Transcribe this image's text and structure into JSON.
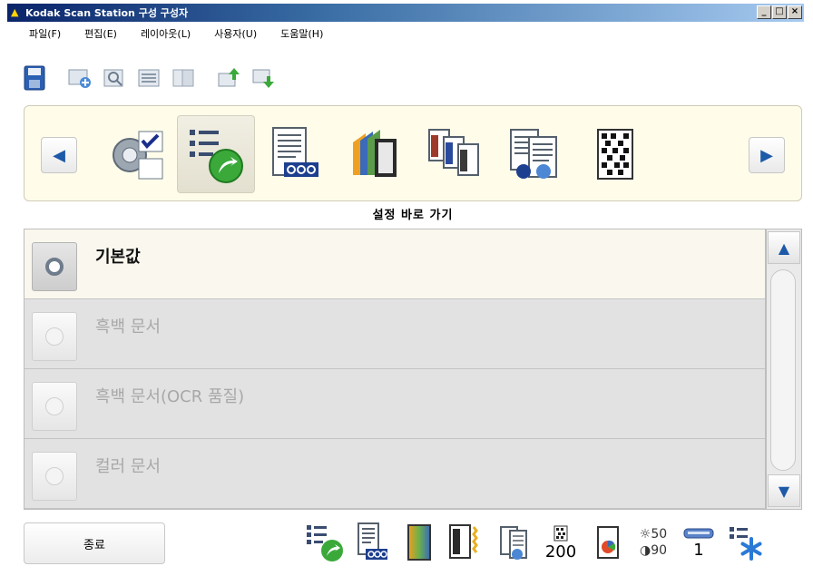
{
  "window": {
    "title": "Kodak Scan Station 구성 구성자",
    "controls": [
      "_",
      "□",
      "×"
    ]
  },
  "menu": {
    "items": [
      "파일(F)",
      "편집(E)",
      "레이아웃(L)",
      "사용자(U)",
      "도움말(H)"
    ]
  },
  "ribbon": {
    "section_title": "설정 바로 가기"
  },
  "shortcuts": {
    "items": [
      {
        "label": "기본값",
        "selected": true
      },
      {
        "label": "흑백 문서",
        "selected": false
      },
      {
        "label": "흑백 문서(OCR 품질)",
        "selected": false
      },
      {
        "label": "컬러 문서",
        "selected": false
      }
    ]
  },
  "footer": {
    "close_label": "종료",
    "resolution": "200",
    "brightness": "50",
    "contrast": "90",
    "count": "1"
  },
  "colors": {
    "accent": "#1d5aa8",
    "green": "#3aa93a",
    "ribbon_bg": "#fffcea",
    "selected_row": "#faf8ee"
  }
}
